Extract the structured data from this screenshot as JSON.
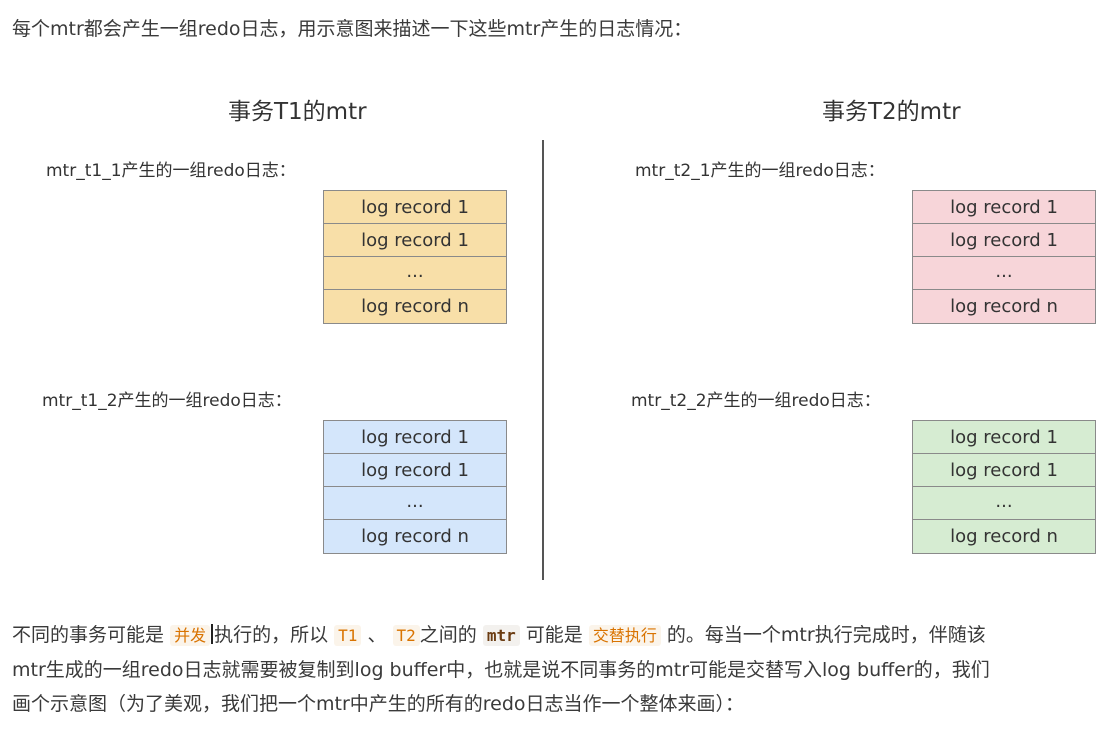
{
  "intro": "每个mtr都会产生一组redo日志，用示意图来描述一下这些mtr产生的日志情况：",
  "columns": [
    {
      "title": "事务T1的mtr",
      "groups": [
        {
          "label": "mtr_t1_1产生的一组redo日志：",
          "color": "#f8dfa8",
          "records": [
            "log record 1",
            "log record 1",
            "...",
            "log record n"
          ]
        },
        {
          "label": "mtr_t1_2产生的一组redo日志：",
          "color": "#d4e6fb",
          "records": [
            "log record 1",
            "log record 1",
            "...",
            "log record n"
          ]
        }
      ]
    },
    {
      "title": "事务T2的mtr",
      "groups": [
        {
          "label": "mtr_t2_1产生的一组redo日志：",
          "color": "#f7d5d9",
          "records": [
            "log record 1",
            "log record 1",
            "...",
            "log record n"
          ]
        },
        {
          "label": "mtr_t2_2产生的一组redo日志：",
          "color": "#d6ecd2",
          "records": [
            "log record 1",
            "log record 1",
            "...",
            "log record n"
          ]
        }
      ]
    }
  ],
  "paragraph": {
    "line1_a": "不同的事务可能是",
    "concurrent": "并发",
    "line1_b": "执行的，所以",
    "t1": "T1",
    "sep": "、",
    "t2": "T2",
    "line1_c": "之间的",
    "mtr": "mtr",
    "line1_d": "可能是",
    "interleave": "交替执行",
    "line1_e": "的。每当一个mtr执行完成时，伴随该",
    "line2": "mtr生成的一组redo日志就需要被复制到log buffer中，也就是说不同事务的mtr可能是交替写入log buffer的，我们",
    "line3": "画个示意图（为了美观，我们把一个mtr中产生的所有的redo日志当作一个整体来画）："
  }
}
